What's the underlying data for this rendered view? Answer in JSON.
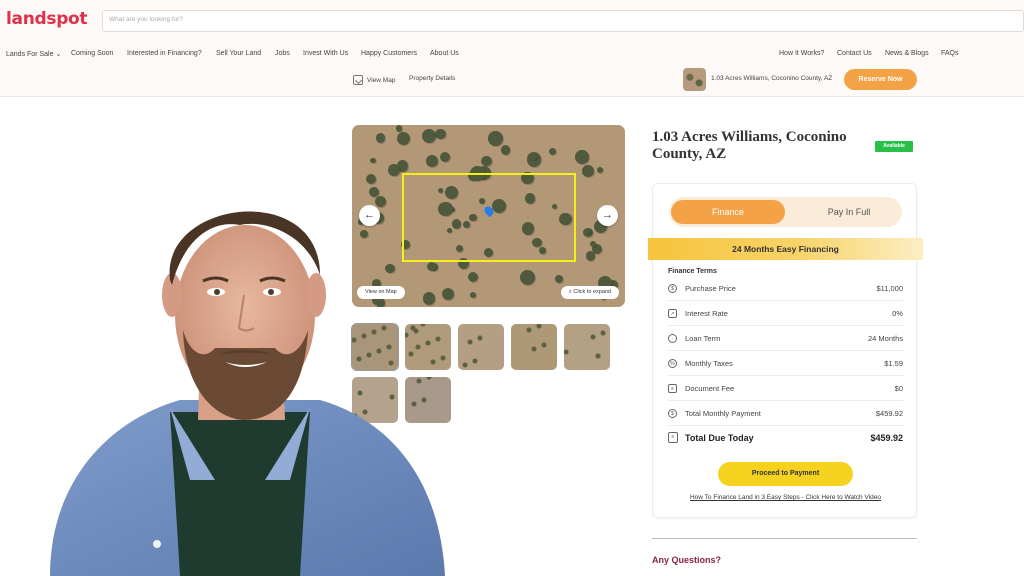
{
  "header": {
    "logo": "landspot",
    "search_placeholder": "What are you looking for?",
    "nav_left": [
      "Lands For Sale",
      "Coming Soon",
      "Interested in Financing?",
      "Sell Your Land",
      "Jobs",
      "Invest With Us",
      "Happy Customers",
      "About Us"
    ],
    "nav_right": [
      "How It Works?",
      "Contact Us",
      "News & Blogs",
      "FAQs"
    ],
    "lands_dropdown_caret": "⌄",
    "subnav": {
      "view_map": "View Map",
      "property_details": "Property Details"
    },
    "property_label": "1.03 Acres Williams, Coconino County, AZ",
    "reserve_button": "Reserve Now"
  },
  "gallery": {
    "prev_arrow": "←",
    "next_arrow": "→",
    "view_on_map": "View on Map",
    "click_to_expand": "Click to expand",
    "thumbnail_count": 7
  },
  "property": {
    "title": "1.03 Acres Williams, Coconino County, AZ",
    "status_badge": "Available"
  },
  "finance_card": {
    "tab_finance": "Finance",
    "tab_pay_in_full": "Pay In Full",
    "banner": "24 Months Easy Financing",
    "terms_title": "Finance Terms",
    "rows": [
      {
        "icon": "dollar-icon",
        "label": "Purchase Price",
        "value": "$11,000"
      },
      {
        "icon": "chart-icon",
        "label": "Interest Rate",
        "value": "0%"
      },
      {
        "icon": "clock-icon",
        "label": "Loan Term",
        "value": "24 Months"
      },
      {
        "icon": "tax-icon",
        "label": "Monthly Taxes",
        "value": "$1.59"
      },
      {
        "icon": "document-icon",
        "label": "Document Fee",
        "value": "$0"
      },
      {
        "icon": "dollar-icon",
        "label": "Total Monthly Payment",
        "value": "$459.92"
      }
    ],
    "total_label": "Total Due Today",
    "total_value": "$459.92",
    "proceed_button": "Proceed to Payment",
    "video_link": "How To Finance Land in 3 Easy Steps - Click Here to Watch Video"
  },
  "questions_heading": "Any Questions?",
  "colors": {
    "brand": "#e0304a",
    "accent": "#f3a346",
    "proceed": "#f5d21f",
    "available": "#29c04a",
    "questions": "#8a2247"
  }
}
